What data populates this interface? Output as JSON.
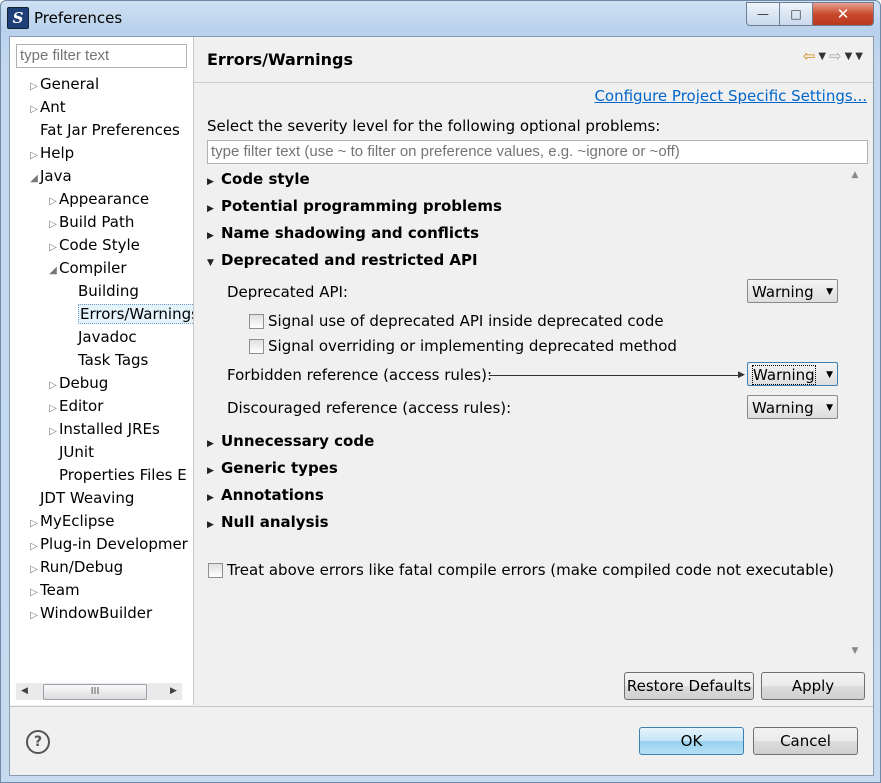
{
  "window": {
    "title": "Preferences",
    "app_icon_glyph": "S",
    "buttons": {
      "minimize": "—",
      "maximize": "□",
      "close": "✕"
    }
  },
  "left": {
    "filter_placeholder": "type filter text",
    "tree": [
      {
        "label": "General",
        "arrow": "▷"
      },
      {
        "label": "Ant",
        "arrow": "▷"
      },
      {
        "label": "Fat Jar Preferences",
        "arrow": ""
      },
      {
        "label": "Help",
        "arrow": "▷"
      },
      {
        "label": "Java",
        "arrow": "◢"
      },
      {
        "label": "Appearance",
        "arrow": "▷"
      },
      {
        "label": "Build Path",
        "arrow": "▷"
      },
      {
        "label": "Code Style",
        "arrow": "▷"
      },
      {
        "label": "Compiler",
        "arrow": "◢"
      },
      {
        "label": "Building",
        "arrow": ""
      },
      {
        "label": "Errors/Warnings",
        "arrow": ""
      },
      {
        "label": "Javadoc",
        "arrow": ""
      },
      {
        "label": "Task Tags",
        "arrow": ""
      },
      {
        "label": "Debug",
        "arrow": "▷"
      },
      {
        "label": "Editor",
        "arrow": "▷"
      },
      {
        "label": "Installed JREs",
        "arrow": "▷"
      },
      {
        "label": "JUnit",
        "arrow": ""
      },
      {
        "label": "Properties Files E",
        "arrow": ""
      },
      {
        "label": "JDT Weaving",
        "arrow": ""
      },
      {
        "label": "MyEclipse",
        "arrow": "▷"
      },
      {
        "label": "Plug-in Developmer",
        "arrow": "▷"
      },
      {
        "label": "Run/Debug",
        "arrow": "▷"
      },
      {
        "label": "Team",
        "arrow": "▷"
      },
      {
        "label": "WindowBuilder",
        "arrow": "▷"
      }
    ],
    "scroll_thumb": "III"
  },
  "right": {
    "title": "Errors/Warnings",
    "nav": {
      "back": "⇦",
      "fwd": "⇨",
      "drop": "▼"
    },
    "config_link": "Configure Project Specific Settings...",
    "severity_label": "Select the severity level for the following optional problems:",
    "problems_filter_placeholder": "type filter text (use ~ to filter on preference values, e.g. ~ignore or ~off)",
    "sections": [
      {
        "label": "Code style",
        "tri": "▶"
      },
      {
        "label": "Potential programming problems",
        "tri": "▶"
      },
      {
        "label": "Name shadowing and conflicts",
        "tri": "▶"
      },
      {
        "label": "Deprecated and restricted API",
        "tri": "▼"
      },
      {
        "label": "Unnecessary code",
        "tri": "▶"
      },
      {
        "label": "Generic types",
        "tri": "▶"
      },
      {
        "label": "Annotations",
        "tri": "▶"
      },
      {
        "label": "Null analysis",
        "tri": "▶"
      }
    ],
    "deprecated": {
      "deprecated_api_label": "Deprecated API:",
      "deprecated_api_value": "Warning",
      "signal_use_label": "Signal use of deprecated API inside deprecated code",
      "signal_use_checked": false,
      "signal_override_label": "Signal overriding or implementing deprecated method",
      "signal_override_checked": false,
      "forbidden_label": "Forbidden reference (access rules):",
      "forbidden_value": "Warning",
      "discouraged_label": "Discouraged reference (access rules):",
      "discouraged_value": "Warning"
    },
    "treat_errors_label": "Treat above errors like fatal compile errors (make compiled code not executable)",
    "treat_errors_checked": false,
    "restore_defaults": "Restore Defaults",
    "apply": "Apply"
  },
  "footer": {
    "help": "?",
    "ok": "OK",
    "cancel": "Cancel"
  },
  "colors": {
    "link": "#0066cc",
    "selection": "#e5f3fb",
    "close_button": "#c94b2f"
  }
}
